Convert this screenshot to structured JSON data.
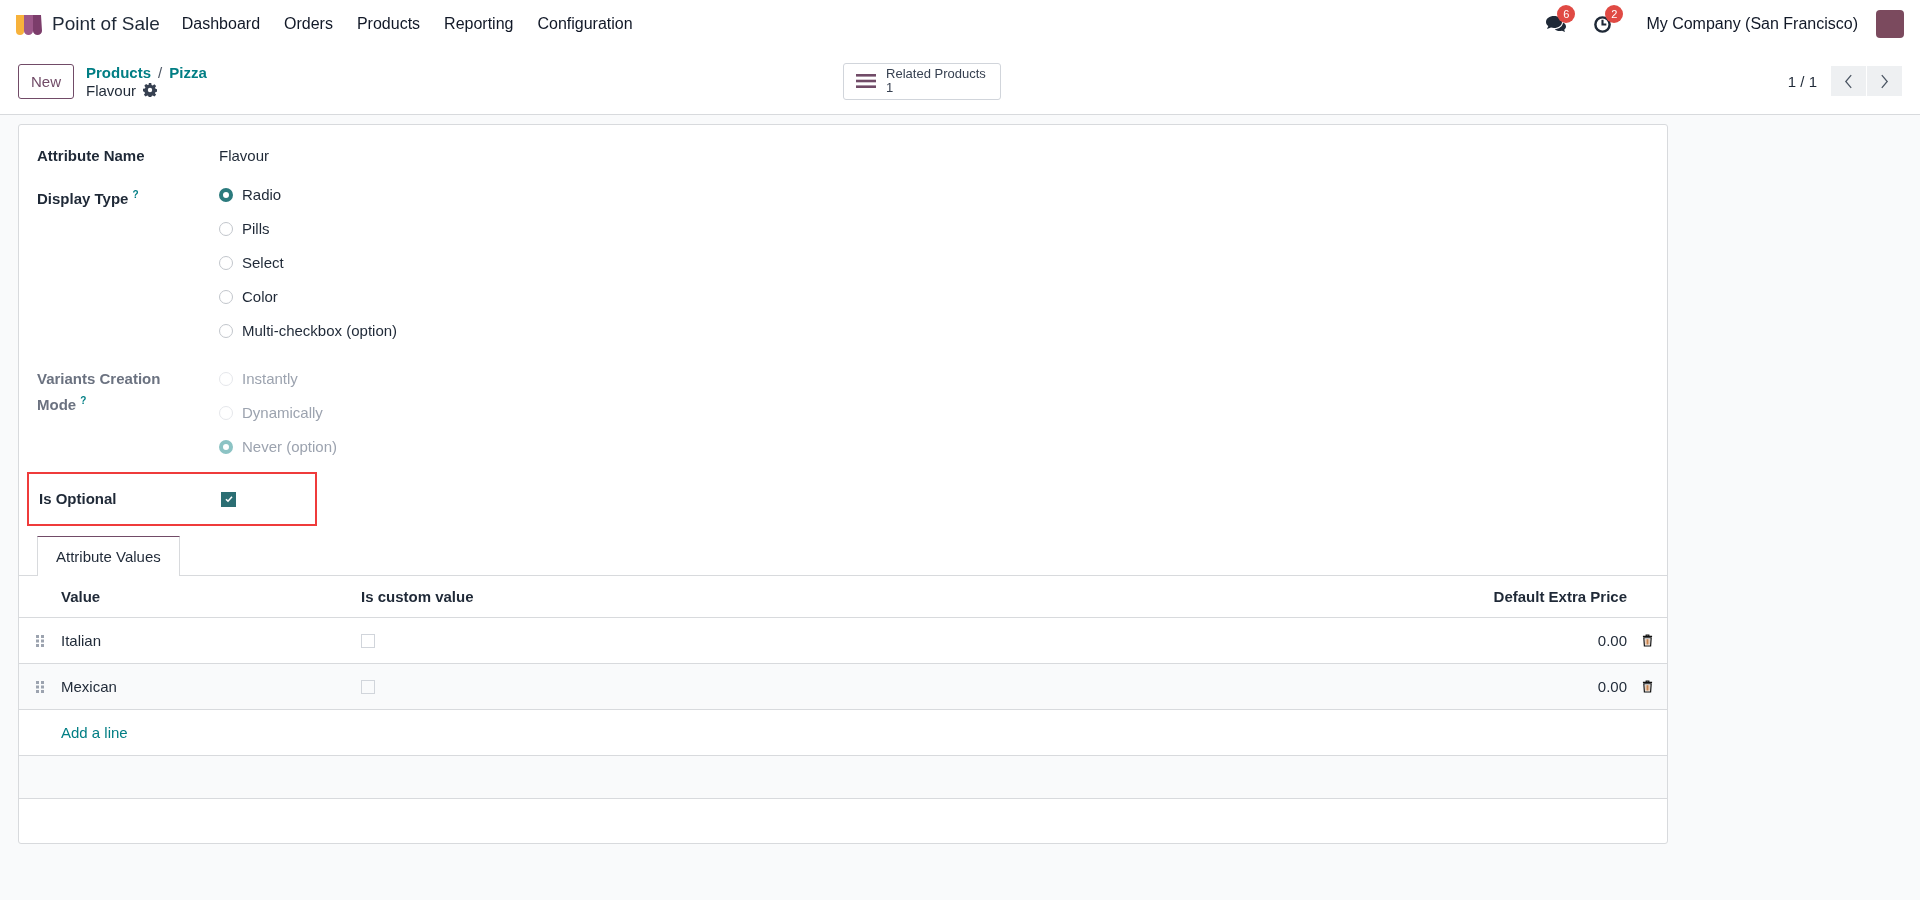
{
  "navbar": {
    "app_name": "Point of Sale",
    "menu": [
      "Dashboard",
      "Orders",
      "Products",
      "Reporting",
      "Configuration"
    ],
    "messages_badge": "6",
    "activities_badge": "2",
    "company": "My Company (San Francisco)"
  },
  "control_panel": {
    "new_button": "New",
    "breadcrumbs": [
      "Products",
      "Pizza"
    ],
    "breadcrumb_separator": "/",
    "current": "Flavour",
    "smart_button": {
      "label": "Related Products",
      "count": "1"
    },
    "pager": "1 / 1"
  },
  "form": {
    "attribute_name": {
      "label": "Attribute Name",
      "value": "Flavour"
    },
    "display_type": {
      "label": "Display Type",
      "help": "?",
      "disabled": false,
      "options": [
        {
          "label": "Radio",
          "selected": true
        },
        {
          "label": "Pills",
          "selected": false
        },
        {
          "label": "Select",
          "selected": false
        },
        {
          "label": "Color",
          "selected": false
        },
        {
          "label": "Multi-checkbox (option)",
          "selected": false
        }
      ]
    },
    "variants_creation_mode": {
      "label": "Variants Creation Mode",
      "help": "?",
      "disabled": true,
      "options": [
        {
          "label": "Instantly",
          "selected": false
        },
        {
          "label": "Dynamically",
          "selected": false
        },
        {
          "label": "Never (option)",
          "selected": true
        }
      ]
    },
    "is_optional": {
      "label": "Is Optional",
      "checked": true,
      "highlighted": true
    }
  },
  "tabs": [
    {
      "label": "Attribute Values",
      "selected": true
    }
  ],
  "table": {
    "columns": [
      "Value",
      "Is custom value",
      "Default Extra Price"
    ],
    "rows": [
      {
        "value": "Italian",
        "is_custom_value": false,
        "default_extra_price": "0.00"
      },
      {
        "value": "Mexican",
        "is_custom_value": false,
        "default_extra_price": "0.00"
      }
    ],
    "add_line": "Add a line"
  }
}
